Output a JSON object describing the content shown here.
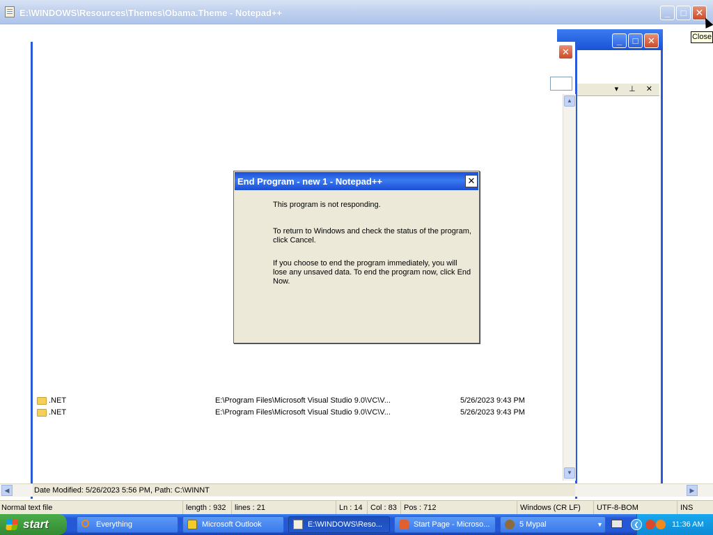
{
  "notepad": {
    "title": "E:\\WINDOWS\\Resources\\Themes\\Obama.Theme - Notepad++",
    "min_glyph": "_",
    "max_glyph": "□",
    "close_glyph": "✕",
    "close_tooltip": "Close",
    "status": {
      "file_type": "Normal text file",
      "length": "length : 932",
      "lines": "lines : 21",
      "ln": "Ln : 14",
      "col": "Col : 83",
      "pos": "Pos : 712",
      "eol": "Windows (CR LF)",
      "encoding": "UTF-8-BOM",
      "mode": "INS"
    }
  },
  "explorer": {
    "close_glyph": "✕",
    "files": [
      {
        "name": ".NET",
        "path": "E:\\Program Files\\Microsoft Visual Studio 9.0\\VC\\V...",
        "date": "5/26/2023 9:43 PM"
      },
      {
        "name": ".NET",
        "path": "E:\\Program Files\\Microsoft Visual Studio 9.0\\VC\\V...",
        "date": "5/26/2023 9:43 PM"
      }
    ],
    "status": "Date Modified: 5/26/2023 5:56 PM, Path: C:\\WINNT"
  },
  "bg_window": {
    "min_glyph": "_",
    "max_glyph": "□",
    "close_glyph": "✕",
    "panel_buttons": "▾ ⊥ ✕"
  },
  "dialog": {
    "title": "End Program - new 1 - Notepad++",
    "close_glyph": "✕",
    "p1": "This program is not responding.",
    "p2": "To return to Windows and check the status of the program, click Cancel.",
    "p3": "If you choose to end the program immediately, you will lose any unsaved data. To end the program now, click End Now."
  },
  "taskbar": {
    "start": "start",
    "buttons": [
      {
        "label": "Everything",
        "icon": "search-icon"
      },
      {
        "label": "Microsoft Outlook",
        "icon": "outlook-icon"
      },
      {
        "label": "E:\\WINDOWS\\Reso...",
        "icon": "notepad-icon"
      },
      {
        "label": "Start Page - Microso...",
        "icon": "visual-studio-icon"
      },
      {
        "label": "5 Mypal",
        "icon": "mypal-icon"
      }
    ],
    "clock": "11:36 AM"
  },
  "colors": {
    "xp_blue": "#2458d6",
    "start_green": "#338a33",
    "dialog_bg": "#ece9d8",
    "tooltip_bg": "#ffffe1"
  }
}
